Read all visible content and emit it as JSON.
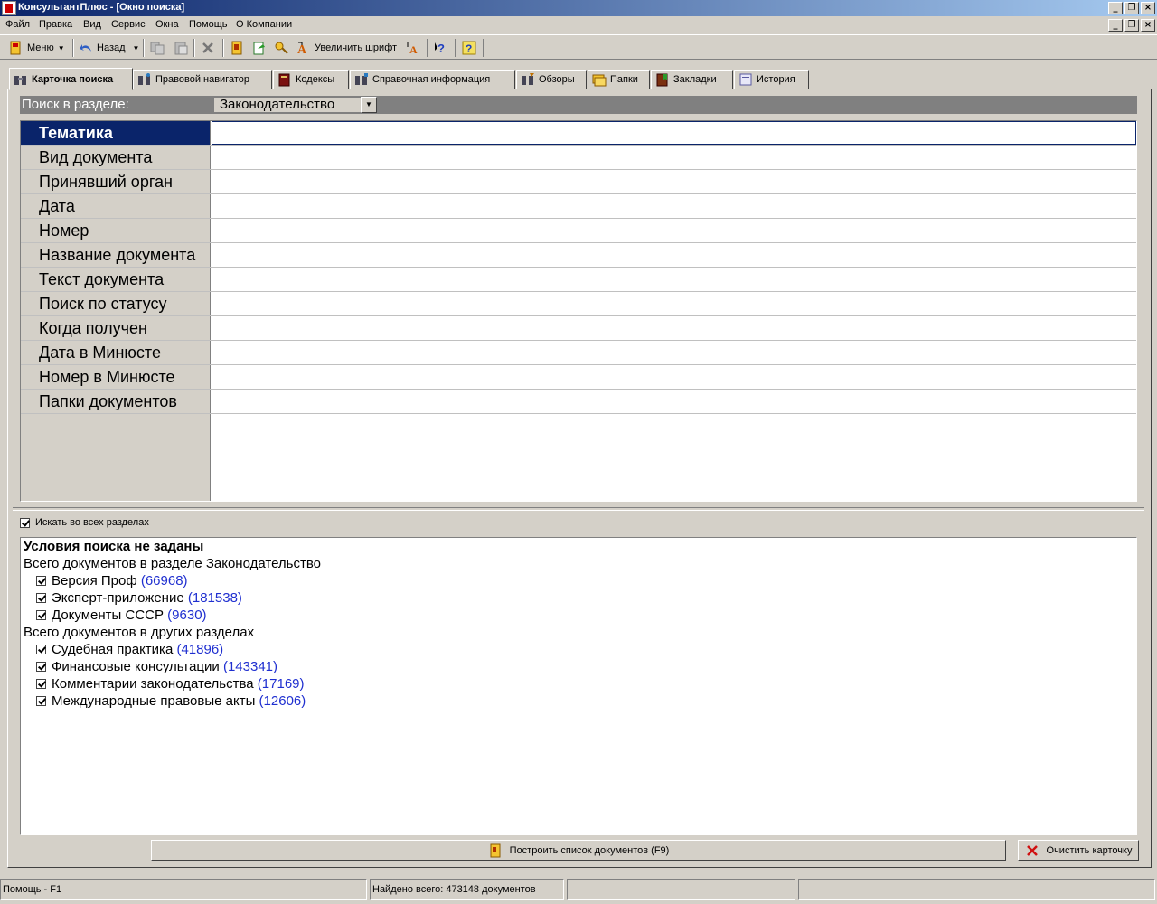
{
  "window": {
    "title": "КонсультантПлюс - [Окно поиска]"
  },
  "menu": [
    "Файл",
    "Правка",
    "Вид",
    "Сервис",
    "Окна",
    "Помощь",
    "О Компании"
  ],
  "toolbar": {
    "menu_label": "Меню",
    "back_label": "Назад",
    "font_label": "Увеличить шрифт"
  },
  "tabs": [
    "Карточка поиска",
    "Правовой навигатор",
    "Кодексы",
    "Справочная информация",
    "Обзоры",
    "Папки",
    "Закладки",
    "История"
  ],
  "section": {
    "label": "Поиск в разделе:",
    "value": "Законодательство"
  },
  "card_fields": [
    "Тематика",
    "Вид документа",
    "Принявший орган",
    "Дата",
    "Номер",
    "Название документа",
    "Текст документа",
    "Поиск по статусу",
    "Когда получен",
    "Дата в Минюсте",
    "Номер в Минюсте",
    "Папки документов"
  ],
  "search_all": {
    "label": "Искать во всех разделах",
    "checked": true
  },
  "info": {
    "heading": "Условия поиска не заданы",
    "group1_title": "Всего документов в разделе Законодательство",
    "group1": [
      {
        "name": "Версия Проф",
        "count": "(66968)"
      },
      {
        "name": "Эксперт-приложение",
        "count": "(181538)"
      },
      {
        "name": "Документы СССР",
        "count": "(9630)"
      }
    ],
    "group2_title": "Всего документов в других разделах",
    "group2": [
      {
        "name": "Судебная практика",
        "count": "(41896)"
      },
      {
        "name": "Финансовые консультации",
        "count": "(143341)"
      },
      {
        "name": "Комментарии законодательства",
        "count": "(17169)"
      },
      {
        "name": "Международные правовые акты",
        "count": "(12606)"
      }
    ]
  },
  "buttons": {
    "build_list": "Построить список документов (F9)",
    "clear_card": "Очистить карточку"
  },
  "status": {
    "help": "Помощь - F1",
    "found": "Найдено всего: 473148 документов"
  }
}
